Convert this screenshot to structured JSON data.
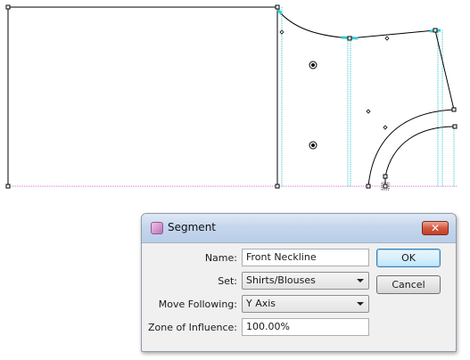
{
  "dialog": {
    "title": "Segment",
    "close_label": "✕",
    "fields": {
      "name": {
        "label": "Name:",
        "value": "Front Neckline"
      },
      "set": {
        "label": "Set:",
        "value": "Shirts/Blouses"
      },
      "move_following": {
        "label": "Move Following:",
        "value": "Y Axis"
      },
      "zone_of_influence": {
        "label": "Zone of Influence:",
        "value": "100.00%"
      }
    },
    "buttons": {
      "ok": "OK",
      "cancel": "Cancel"
    }
  },
  "colors": {
    "pattern_line": "#000000",
    "guide_line": "#2cc6c6",
    "baseline": "#d070d0",
    "selection_handle": "#33cccc",
    "dialog_bg": "#f0f0f0",
    "titlebar": "#c5d7ed",
    "close_button": "#d4563e"
  },
  "icons": {
    "app": "segment-app-icon",
    "close": "close-icon",
    "dropdown": "chevron-down-icon"
  }
}
